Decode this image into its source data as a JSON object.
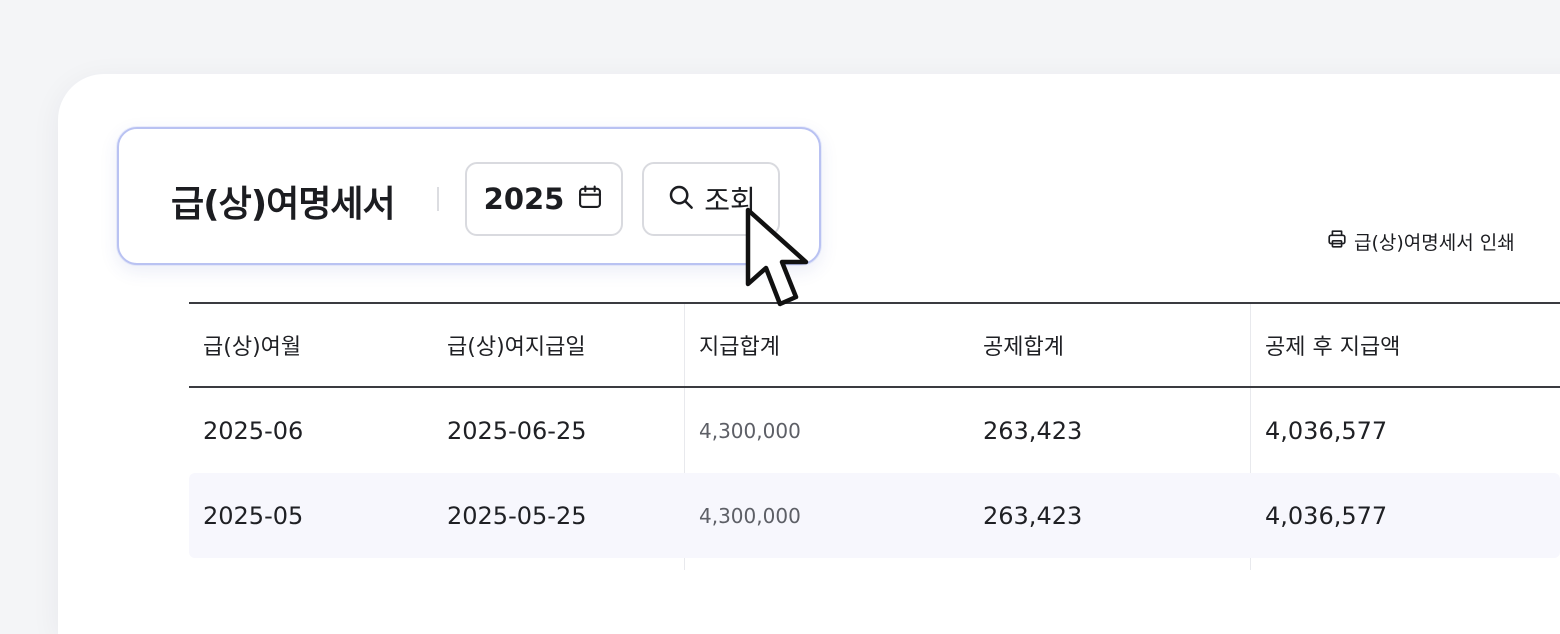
{
  "toolbar": {
    "title": "급(상)여명세서",
    "year": "2025",
    "search_label": "조회"
  },
  "print": {
    "label": "급(상)여명세서 인쇄"
  },
  "table": {
    "headers": [
      "급(상)여월",
      "급(상)여지급일",
      "지급합계",
      "공제합계",
      "공제 후 지급액"
    ],
    "rows": [
      [
        "2025-06",
        "2025-06-25",
        "4,300,000",
        "263,423",
        "4,036,577"
      ],
      [
        "2025-05",
        "2025-05-25",
        "4,300,000",
        "263,423",
        "4,036,577"
      ]
    ]
  },
  "icons": {
    "calendar": "calendar-icon",
    "search": "search-icon",
    "print": "printer-icon",
    "cursor": "mouse-pointer-icon"
  },
  "colors": {
    "toolbar_border": "#b9c2f2",
    "row_highlight": "#f7f7fd",
    "text": "#1f2024"
  }
}
